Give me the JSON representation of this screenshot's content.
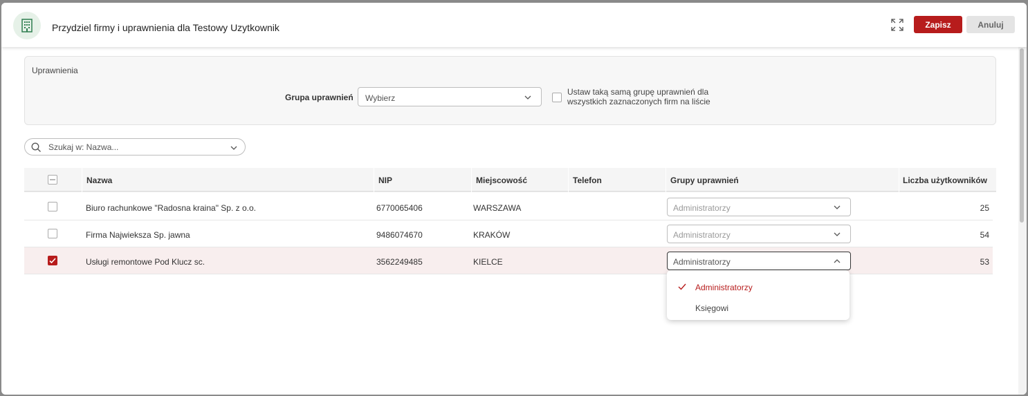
{
  "header": {
    "title": "Przydziel firmy i uprawnienia dla Testowy Uzytkownik",
    "icon": "building-icon",
    "save_label": "Zapisz",
    "cancel_label": "Anuluj",
    "accent_color": "#b71c1c"
  },
  "permissions": {
    "section_title": "Uprawnienia",
    "group_label": "Grupa uprawnień",
    "group_value": "Wybierz",
    "same_group_checked": false,
    "same_group_text": "Ustaw taką samą grupę uprawnień dla wszystkich zaznaczonych firm na liście"
  },
  "search": {
    "placeholder": "Szukaj w: Nazwa..."
  },
  "table": {
    "columns": [
      "Nazwa",
      "NIP",
      "Miejscowość",
      "Telefon",
      "Grupy uprawnień",
      "Liczba użytkowników"
    ],
    "rows": [
      {
        "checked": false,
        "name": "Biuro rachunkowe \"Radosna kraina\" Sp. z o.o.",
        "nip": "6770065406",
        "city": "WARSZAWA",
        "phone": "",
        "group": "Administratorzy",
        "users": "25"
      },
      {
        "checked": false,
        "name": "Firma Najwieksza Sp. jawna",
        "nip": "9486074670",
        "city": "KRAKÓW",
        "phone": "",
        "group": "Administratorzy",
        "users": "54"
      },
      {
        "checked": true,
        "name": "Usługi remontowe Pod Klucz sc.",
        "nip": "3562249485",
        "city": "KIELCE",
        "phone": "",
        "group": "Administratorzy",
        "users": "53"
      }
    ]
  },
  "dropdown": {
    "options": [
      {
        "label": "Administratorzy",
        "selected": true
      },
      {
        "label": "Księgowi",
        "selected": false
      }
    ]
  }
}
